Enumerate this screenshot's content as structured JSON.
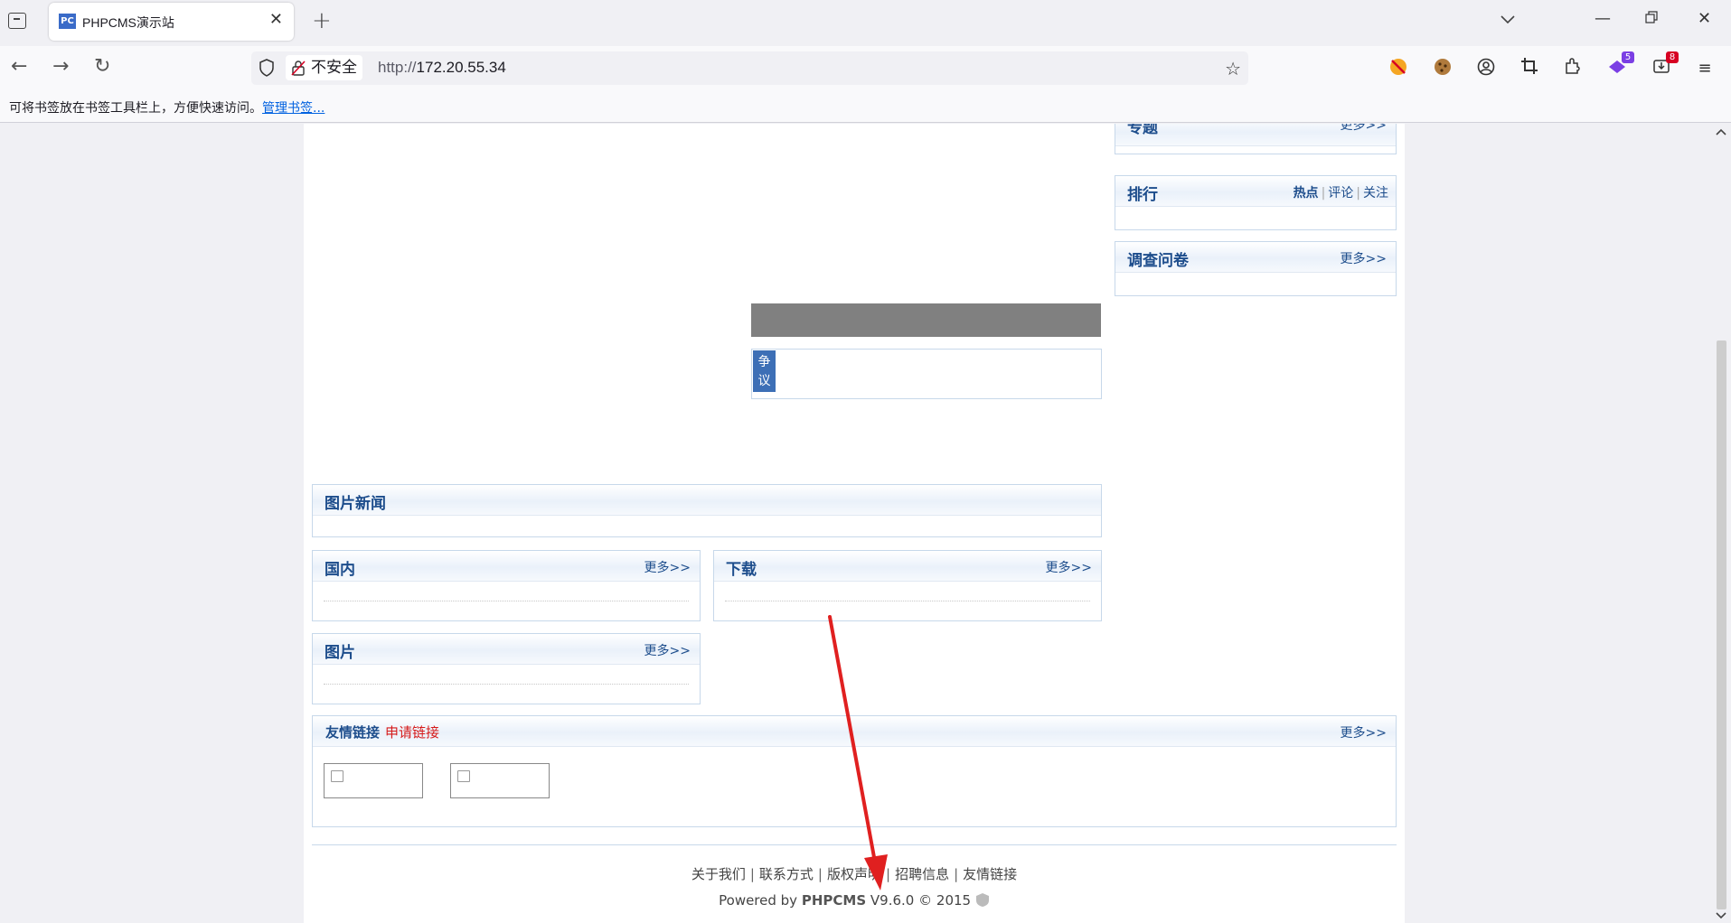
{
  "browser": {
    "tab_title": "PHPCMS演示站",
    "tab_favicon": "PC",
    "insecure_label": "不安全",
    "url_scheme": "http://",
    "url_host": "172.20.55.34",
    "ext_badge_1": "5",
    "ext_badge_2": "8",
    "bookmark_hint": "可将书签放在书签工具栏上，方便快速访问。",
    "bookmark_manage": "管理书签..."
  },
  "sidebar": {
    "topic_title": "专题",
    "topic_more": "更多>>",
    "rank_title": "排行",
    "rank_tabs": [
      "热点",
      "评论",
      "关注"
    ],
    "survey_title": "调查问卷",
    "survey_more": "更多>>"
  },
  "main": {
    "dispute_tag": "争议",
    "photo_news_title": "图片新闻",
    "domestic_title": "国内",
    "domestic_more": "更多>>",
    "download_title": "下载",
    "download_more": "更多>>",
    "pictures_title": "图片",
    "pictures_more": "更多>>"
  },
  "links": {
    "title": "友情链接",
    "apply": "申请链接",
    "more": "更多>>"
  },
  "footer": {
    "links": [
      "关于我们",
      "联系方式",
      "版权声明",
      "招聘信息",
      "友情链接"
    ],
    "powered_prefix": "Powered by",
    "brand": "PHPCMS",
    "version": "V9.6.0",
    "copyright": "© 2015"
  },
  "colors": {
    "accent_blue": "#1d4d8c",
    "annotation_arrow": "#e02020",
    "badge_purple": "#7b3fe4",
    "badge_red": "#d70022"
  }
}
